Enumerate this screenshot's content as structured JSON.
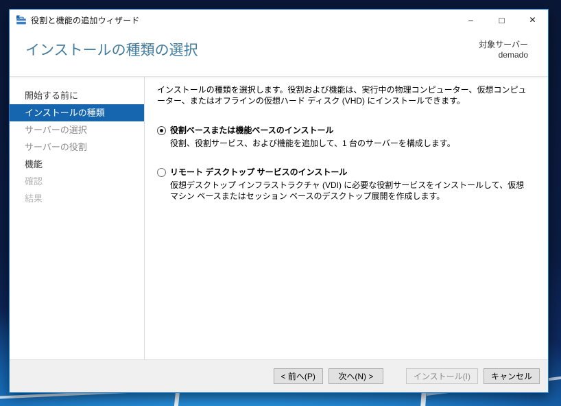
{
  "window": {
    "title": "役割と機能の追加ウィザード",
    "controls": {
      "minimize_glyph": "–",
      "maximize_glyph": "□",
      "close_glyph": "✕"
    }
  },
  "header": {
    "page_title": "インストールの種類の選択",
    "target_server_label": "対象サーバー",
    "target_server_value": "demado"
  },
  "sidebar": {
    "items": [
      {
        "label": "開始する前に",
        "state": "enabled"
      },
      {
        "label": "インストールの種類",
        "state": "selected"
      },
      {
        "label": "サーバーの選択",
        "state": "dimmed"
      },
      {
        "label": "サーバーの役割",
        "state": "dimmed"
      },
      {
        "label": "機能",
        "state": "enabled"
      },
      {
        "label": "確認",
        "state": "disabled"
      },
      {
        "label": "結果",
        "state": "disabled"
      }
    ]
  },
  "content": {
    "intro": "インストールの種類を選択します。役割および機能は、実行中の物理コンピューター、仮想コンピューター、またはオフラインの仮想ハード ディスク (VHD) にインストールできます。",
    "options": [
      {
        "label": "役割ベースまたは機能ベースのインストール",
        "description": "役割、役割サービス、および機能を追加して、1 台のサーバーを構成します。",
        "selected": true
      },
      {
        "label": "リモート デスクトップ サービスのインストール",
        "description": "仮想デスクトップ インフラストラクチャ (VDI) に必要な役割サービスをインストールして、仮想マシン ベースまたはセッション ベースのデスクトップ展開を作成します。",
        "selected": false
      }
    ]
  },
  "footer": {
    "buttons": [
      {
        "label": "< 前へ(P)",
        "state": "enabled"
      },
      {
        "label": "次へ(N) >",
        "state": "enabled"
      },
      {
        "label": "インストール(I)",
        "state": "disabled"
      },
      {
        "label": "キャンセル",
        "state": "enabled"
      }
    ]
  },
  "colors": {
    "selection_blue": "#1565af",
    "header_title_blue": "#417b9e",
    "window_border_blue": "#1883d7"
  }
}
